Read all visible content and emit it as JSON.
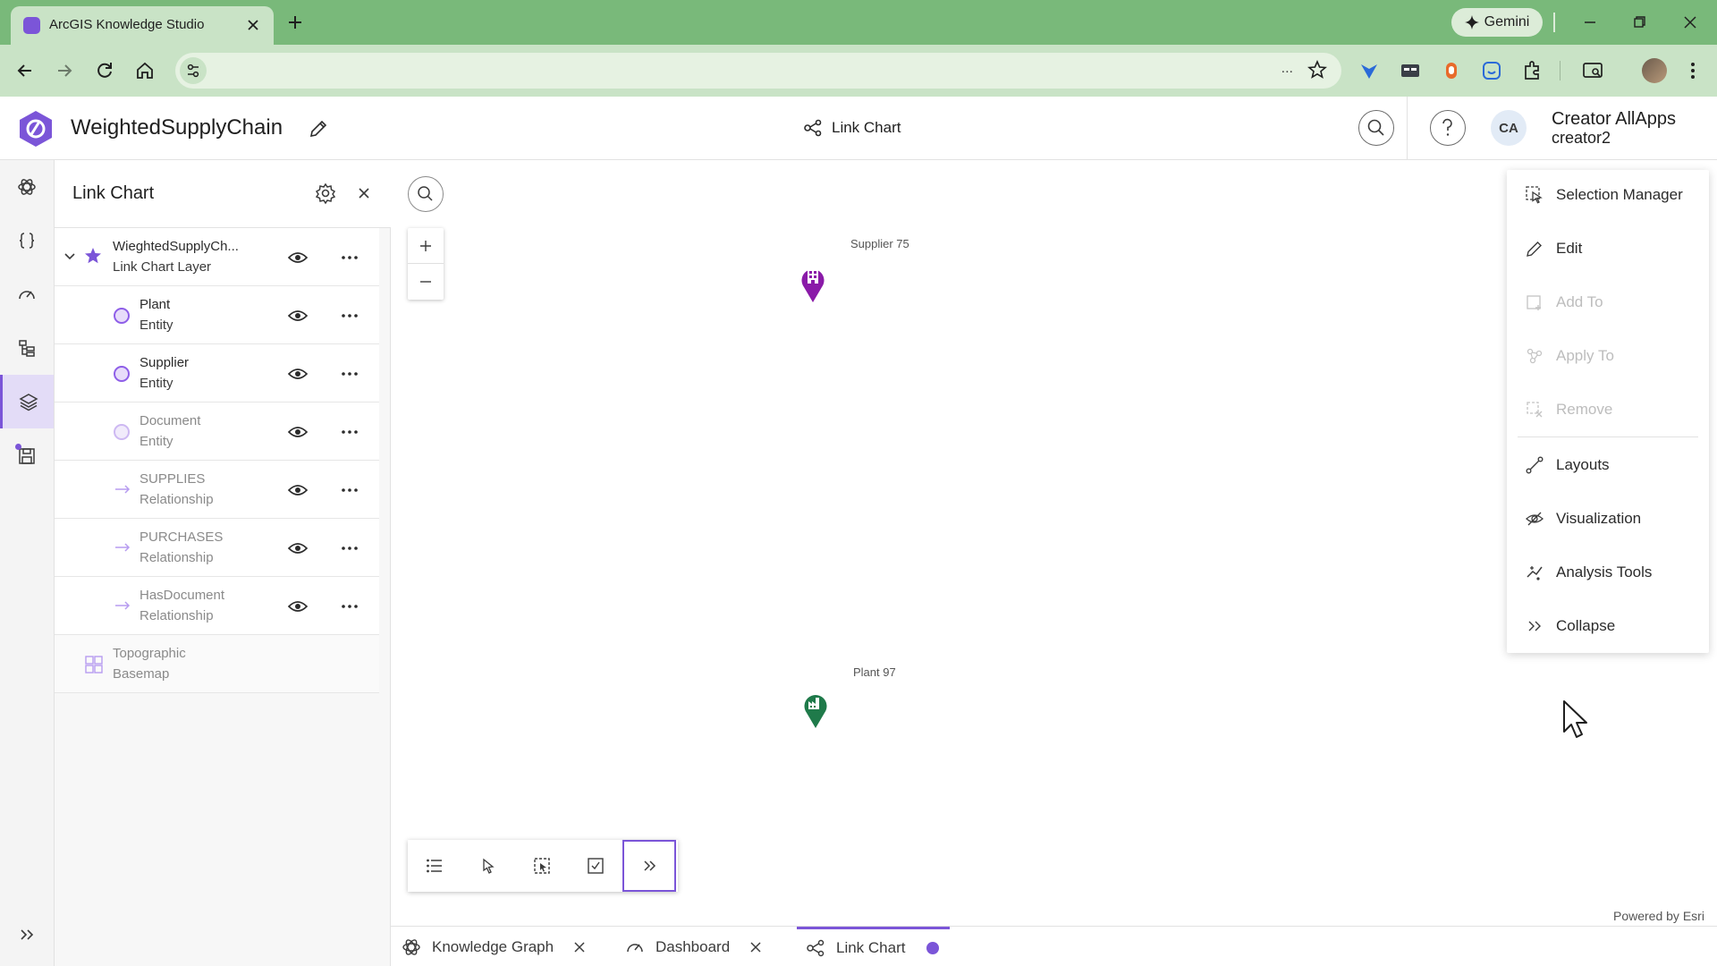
{
  "browser": {
    "tab_title": "ArcGIS Knowledge Studio",
    "gemini_label": "Gemini",
    "omnibox_ellipsis": "...",
    "icons": [
      "close-icon",
      "plus-icon",
      "back-icon",
      "forward-icon",
      "reload-icon",
      "home-icon",
      "site-info-icon",
      "star-icon",
      "extensions-icon",
      "more-vert-icon"
    ]
  },
  "app": {
    "project_title": "WeightedSupplyChain",
    "header_tab_label": "Link Chart",
    "user": {
      "initials": "CA",
      "name": "Creator AllApps",
      "username": "creator2"
    },
    "accent_color": "#7b55d8"
  },
  "panel": {
    "title": "Link Chart",
    "layer_group": {
      "name": "WieghtedSupplyCh...",
      "type": "Link Chart Layer"
    },
    "layers": [
      {
        "name": "Plant",
        "type": "Entity",
        "kind": "entity",
        "dim": false
      },
      {
        "name": "Supplier",
        "type": "Entity",
        "kind": "entity",
        "dim": false
      },
      {
        "name": "Document",
        "type": "Entity",
        "kind": "entity",
        "dim": true
      },
      {
        "name": "SUPPLIES",
        "type": "Relationship",
        "kind": "relationship",
        "dim": true
      },
      {
        "name": "PURCHASES",
        "type": "Relationship",
        "kind": "relationship",
        "dim": true
      },
      {
        "name": "HasDocument",
        "type": "Relationship",
        "kind": "relationship",
        "dim": true
      }
    ],
    "basemap": {
      "name": "Topographic",
      "type": "Basemap"
    }
  },
  "map": {
    "nodes": [
      {
        "label": "Supplier 75",
        "color": "#8a1aa8",
        "icon": "building-icon"
      },
      {
        "label": "Plant 97",
        "color": "#1f7a4a",
        "icon": "factory-icon"
      }
    ],
    "powered_by": "Powered by Esri"
  },
  "context_menu": {
    "items": [
      {
        "label": "Selection Manager",
        "icon": "selection-manager-icon",
        "disabled": false
      },
      {
        "label": "Edit",
        "icon": "pencil-icon",
        "disabled": false
      },
      {
        "label": "Add To",
        "icon": "add-to-icon",
        "disabled": true
      },
      {
        "label": "Apply To",
        "icon": "apply-to-icon",
        "disabled": true
      },
      {
        "label": "Remove",
        "icon": "remove-icon",
        "disabled": true
      },
      {
        "label": "Layouts",
        "icon": "layouts-icon",
        "disabled": false
      },
      {
        "label": "Visualization",
        "icon": "visualization-icon",
        "disabled": false
      },
      {
        "label": "Analysis Tools",
        "icon": "analysis-tools-icon",
        "disabled": false
      },
      {
        "label": "Collapse",
        "icon": "chevrons-right-icon",
        "disabled": false
      }
    ]
  },
  "bottom_tabs": [
    {
      "label": "Knowledge Graph",
      "closable": true
    },
    {
      "label": "Dashboard",
      "closable": true
    },
    {
      "label": "Link Chart",
      "active": true
    }
  ]
}
